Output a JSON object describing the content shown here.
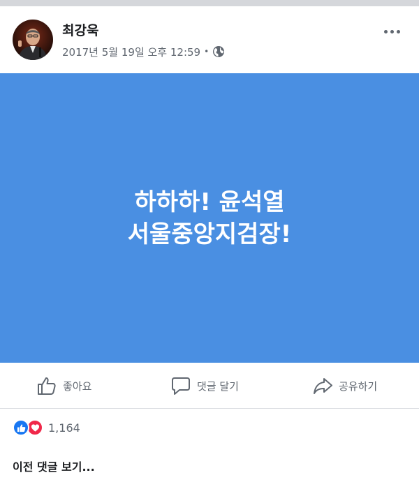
{
  "post": {
    "author": "최강욱",
    "timestamp": "2017년 5월 19일 오후 12:59",
    "separator": "•",
    "privacy_icon": "globe-icon",
    "more_icon": "more-options-icon",
    "image": {
      "background_color": "#4a8fe2",
      "text_color": "#ffffff",
      "lines": [
        "하하하! 윤석열",
        "서울중앙지검장!"
      ]
    }
  },
  "actions": {
    "like_label": "좋아요",
    "comment_label": "댓글 달기",
    "share_label": "공유하기"
  },
  "reactions": {
    "icons": [
      "like-reaction-icon",
      "love-reaction-icon"
    ],
    "count": "1,164",
    "like_color": "#1877f2",
    "love_color": "#f0284a"
  },
  "comments": {
    "view_previous_label": "이전 댓글 보기..."
  }
}
